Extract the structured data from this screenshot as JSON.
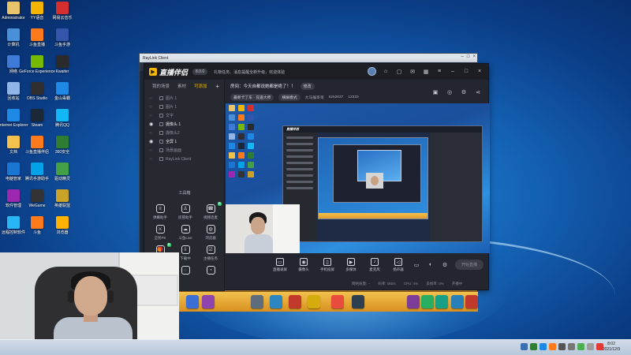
{
  "desktop": {
    "icons": [
      {
        "label": "Administrator",
        "color": "#e9c46a"
      },
      {
        "label": "YY语音",
        "color": "#f4b400"
      },
      {
        "label": "网易云音乐",
        "color": "#d32f2f"
      },
      {
        "label": "计算机",
        "color": "#4a90d9"
      },
      {
        "label": "斗鱼直播",
        "color": "#ff7a1a"
      },
      {
        "label": "斗鱼手游",
        "color": "#3355aa"
      },
      {
        "label": "网络",
        "color": "#3e7bd6"
      },
      {
        "label": "GeForce Experience",
        "color": "#76b900"
      },
      {
        "label": "Kwaiter",
        "color": "#2b2b2b"
      },
      {
        "label": "回收站",
        "color": "#8fb6e6"
      },
      {
        "label": "OBS Studio",
        "color": "#302e31"
      },
      {
        "label": "金山毒霸",
        "color": "#1e88e5"
      },
      {
        "label": "Internet Explorer",
        "color": "#1e88e5"
      },
      {
        "label": "Steam",
        "color": "#1b2838"
      },
      {
        "label": "腾讯QQ",
        "color": "#12b7f5"
      },
      {
        "label": "文档",
        "color": "#f2c14e"
      },
      {
        "label": "斗鱼直播伴侣",
        "color": "#ff7a1a"
      },
      {
        "label": "360安全",
        "color": "#2e7d32"
      },
      {
        "label": "电脑管家",
        "color": "#1976d2"
      },
      {
        "label": "腾讯手游助手",
        "color": "#00a2e8"
      },
      {
        "label": "驱动精灵",
        "color": "#43a047"
      },
      {
        "label": "软件管理",
        "color": "#9c27b0"
      },
      {
        "label": "WeGame",
        "color": "#333333"
      },
      {
        "label": "英雄联盟",
        "color": "#c9a227"
      },
      {
        "label": "远程控制软件",
        "color": "#29b6f6"
      },
      {
        "label": "斗鱼",
        "color": "#ff7a1a"
      },
      {
        "label": "浏览器",
        "color": "#ffb300"
      }
    ]
  },
  "back_window": {
    "title": "RayLink Client",
    "controls": [
      "–",
      "□",
      "×"
    ]
  },
  "app": {
    "brand": "直播伴侣",
    "version": "8.0.0",
    "notice": "礼物任务、消息提醒全新升级，欢迎体验",
    "header_icons": [
      "avatar",
      "shirt-icon",
      "message-icon",
      "mail-icon",
      "grid-icon",
      "menu-icon",
      "minimize-icon",
      "maximize-icon",
      "close-icon"
    ],
    "left_tabs": {
      "tab1": "我的场景",
      "tab2": "素材",
      "tab3": "可添加",
      "plus": "+"
    },
    "scenes": [
      {
        "label": "图片 1",
        "on": false
      },
      {
        "label": "图片 1",
        "on": false
      },
      {
        "label": "文字",
        "on": false
      },
      {
        "label": "摄像头 1",
        "on": true
      },
      {
        "label": "摄像头2",
        "on": false
      },
      {
        "label": "全屏 1",
        "on": true
      },
      {
        "label": "场景画面",
        "on": false
      },
      {
        "label": "RayLink Client",
        "on": false
      }
    ],
    "tools_title": "工具箱",
    "tools": [
      {
        "label": "弹幕助手",
        "badge": ""
      },
      {
        "label": "房管助手",
        "badge": ""
      },
      {
        "label": "视频连麦",
        "badge": "新"
      },
      {
        "label": "全民PK",
        "badge": ""
      },
      {
        "label": "斗鱼Live",
        "badge": ""
      },
      {
        "label": "浏览器",
        "badge": ""
      },
      {
        "label": "礼物",
        "badge": "新"
      },
      {
        "label": "下载中",
        "badge": ""
      },
      {
        "label": "主播任务",
        "badge": ""
      },
      {
        "label": "更多",
        "badge": ""
      },
      {
        "label": "",
        "badge": ""
      },
      {
        "label": "",
        "badge": ""
      }
    ],
    "room": {
      "title": "房间：今天自都说她都是绝了！！",
      "modify": "修改",
      "category": "最新卡丁车 · 竞速大师",
      "mode": "横屏模式",
      "anchor": "大马猴哥哥",
      "room_id": "6252637",
      "fans": "12333"
    },
    "controls": [
      {
        "label": "直播录屏",
        "icon": "▭"
      },
      {
        "label": "摄像头",
        "icon": "◉"
      },
      {
        "label": "手机投屏",
        "icon": "▯"
      },
      {
        "label": "多媒体",
        "icon": "▶"
      },
      {
        "label": "麦克风",
        "icon": "♪"
      },
      {
        "label": "扬声器",
        "icon": "◁"
      }
    ],
    "start_label": "开始直播",
    "stats": [
      "网络质量: --",
      "码率: 0kb/s",
      "CPU: 4%",
      "丢帧率: 0%",
      "开播中"
    ]
  },
  "taskbar": {
    "time": "8:02",
    "date": "2021/12/9"
  }
}
